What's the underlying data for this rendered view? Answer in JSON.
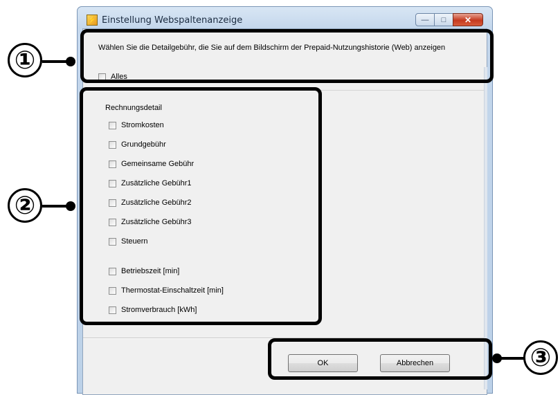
{
  "window": {
    "title": "Einstellung Webspaltenanzeige",
    "app_icon": "settings-lightning-icon",
    "controls": {
      "minimize": "—",
      "maximize": "□",
      "close": "✕"
    }
  },
  "instruction": "Wählen Sie die Detailgebühr, die Sie auf dem Bildschirm der Prepaid-Nutzungshistorie (Web) anzeigen",
  "select_all": {
    "label": "Alles",
    "checked": false
  },
  "detail_group": {
    "title": "Rechnungsdetail",
    "items": [
      {
        "label": "Stromkosten",
        "checked": false
      },
      {
        "label": "Grundgebühr",
        "checked": false
      },
      {
        "label": "Gemeinsame Gebühr",
        "checked": false
      },
      {
        "label": "Zusätzliche Gebühr1",
        "checked": false
      },
      {
        "label": "Zusätzliche Gebühr2",
        "checked": false
      },
      {
        "label": "Zusätzliche Gebühr3",
        "checked": false
      },
      {
        "label": "Steuern",
        "checked": false
      },
      {
        "label": "Betriebszeit [min]",
        "checked": false
      },
      {
        "label": "Thermostat-Einschaltzeit [min]",
        "checked": false
      },
      {
        "label": "Stromverbrauch [kWh]",
        "checked": false
      }
    ]
  },
  "buttons": {
    "ok": "OK",
    "cancel": "Abbrechen"
  },
  "callouts": {
    "one": "①",
    "two": "②",
    "three": "③"
  },
  "colors": {
    "titlebar": "#c4d7ec",
    "close_button": "#c4391f",
    "client": "#f0f0f0",
    "callout": "#000000"
  }
}
